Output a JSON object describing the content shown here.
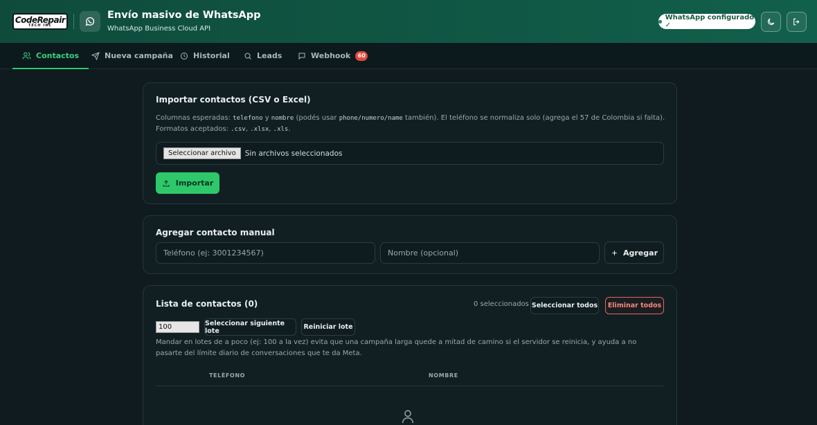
{
  "header": {
    "logo_line1": "CodeRepair",
    "logo_line2": "TECH INC",
    "title": "Envío masivo de WhatsApp",
    "subtitle": "WhatsApp Business Cloud API",
    "status": "WhatsApp configurado ✓"
  },
  "tabs": [
    {
      "label": "Contactos",
      "icon": "user-icon",
      "active": true
    },
    {
      "label": "Nueva campaña",
      "icon": "send-icon"
    },
    {
      "label": "Historial",
      "icon": "clock-icon"
    },
    {
      "label": "Leads",
      "icon": "search-icon"
    },
    {
      "label": "Webhook",
      "icon": "message-icon",
      "badge": "60"
    }
  ],
  "import_card": {
    "title": "Importar contactos (CSV o Excel)",
    "desc_part1": "Columnas esperadas: ",
    "code1": "telefono",
    "desc_part2": " y ",
    "code2": "nombre",
    "desc_part3": " (podés usar ",
    "code3": "phone/numero/name",
    "desc_part4": " también). El teléfono se normaliza solo (agrega el 57 de Colombia si falta). Formatos aceptados: ",
    "code4": ".csv",
    "sep1": ", ",
    "code5": ".xlsx",
    "sep2": ", ",
    "code6": ".xls",
    "desc_end": ".",
    "file_button": "Seleccionar archivo",
    "file_status": "Sin archivos seleccionados",
    "import_button": "Importar"
  },
  "manual_card": {
    "title": "Agregar contacto manual",
    "phone_placeholder": "Teléfono (ej: 3001234567)",
    "name_placeholder": "Nombre (opcional)",
    "add_button": "Agregar"
  },
  "list_card": {
    "title": "Lista de contactos (0)",
    "selected_count": "0 seleccionados",
    "select_all": "Seleccionar todos",
    "delete_all": "Eliminar todos",
    "batch_size": "100",
    "select_next_batch": "Seleccionar siguiente lote",
    "reset_batch": "Reiniciar lote",
    "batch_help": "Mandar en lotes de a poco (ej: 100 a la vez) evita que una campaña larga quede a mitad de camino si el servidor se reinicia, y ayuda a no pasarte del límite diario de conversaciones que te da Meta.",
    "col_phone": "TELÉFONO",
    "col_name": "NOMBRE"
  },
  "colors": {
    "accent": "#2ec86b",
    "header_bg": "#11604b",
    "danger": "#e2685f",
    "badge": "#e2483d"
  }
}
